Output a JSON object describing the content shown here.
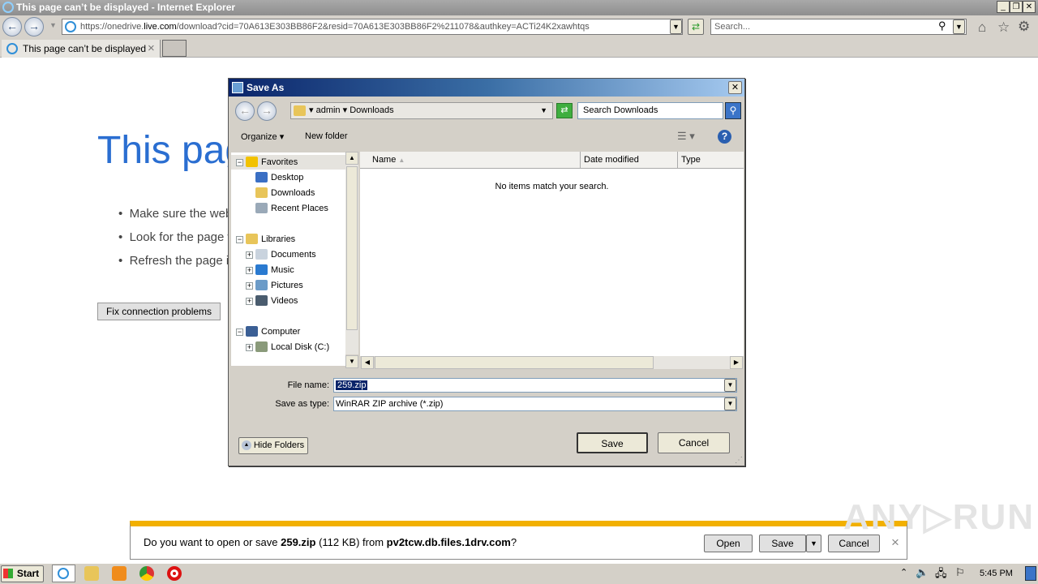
{
  "window": {
    "title": "This page can’t be displayed - Internet Explorer",
    "controls": [
      "_",
      "❐",
      "✕"
    ]
  },
  "address": {
    "prefix": "https://onedrive.",
    "domain": "live.com",
    "suffix": "/download?cid=70A613E303BB86F2&resid=70A613E303BB86F2%211078&authkey=ACTi24K2xawhtqs"
  },
  "search": {
    "placeholder": "Search..."
  },
  "tab": {
    "label": "This page can’t be displayed",
    "close": "×"
  },
  "page": {
    "heading": "This page can’t be displayed",
    "bullets": [
      "Make sure the web address is correct.",
      "Look for the page with your search engine.",
      "Refresh the page in a few minutes."
    ],
    "fix_button": "Fix connection problems"
  },
  "dialog": {
    "title": "Save As",
    "close": "✕",
    "breadcrumb": [
      "admin",
      "Downloads"
    ],
    "search_placeholder": "Search Downloads",
    "organize": "Organize ▾",
    "new_folder": "New folder",
    "columns": [
      "Name",
      "Date modified",
      "Type"
    ],
    "empty_message": "No items match your search.",
    "tree": [
      {
        "label": "Favorites",
        "level": 0,
        "exp": "−",
        "icon": "star",
        "color": "#f2c200"
      },
      {
        "label": "Desktop",
        "level": 1,
        "icon": "desktop",
        "color": "#3a6fc4"
      },
      {
        "label": "Downloads",
        "level": 1,
        "icon": "folder",
        "color": "#e8c55a"
      },
      {
        "label": "Recent Places",
        "level": 1,
        "icon": "recent",
        "color": "#9aa9b8"
      },
      {
        "label": "Libraries",
        "level": 0,
        "exp": "−",
        "icon": "library",
        "color": "#e8c55a",
        "gap": true
      },
      {
        "label": "Documents",
        "level": 1,
        "exp": "+",
        "icon": "documents",
        "color": "#c9d3de"
      },
      {
        "label": "Music",
        "level": 1,
        "exp": "+",
        "icon": "music",
        "color": "#2a7ad0"
      },
      {
        "label": "Pictures",
        "level": 1,
        "exp": "+",
        "icon": "pictures",
        "color": "#6b9bc8"
      },
      {
        "label": "Videos",
        "level": 1,
        "exp": "+",
        "icon": "videos",
        "color": "#4a5c6e"
      },
      {
        "label": "Computer",
        "level": 0,
        "exp": "−",
        "icon": "computer",
        "color": "#3b5f95",
        "gap": true
      },
      {
        "label": "Local Disk (C:)",
        "level": 1,
        "exp": "+",
        "icon": "disk",
        "color": "#8a9a7a"
      }
    ],
    "file_name_label": "File name:",
    "file_name": "259.zip",
    "save_type_label": "Save as type:",
    "save_type": "WinRAR ZIP archive (*.zip)",
    "hide_folders": "Hide Folders",
    "save": "Save",
    "cancel": "Cancel"
  },
  "download_bar": {
    "prefix": "Do you want to open or save ",
    "file": "259.zip",
    "size": " (112 KB) from ",
    "host": "pv2tcw.db.files.1drv.com",
    "suffix": "?",
    "open": "Open",
    "save": "Save",
    "cancel": "Cancel",
    "close": "×"
  },
  "taskbar": {
    "start": "Start",
    "clock": "5:45 PM"
  },
  "watermark": "ANY RUN",
  "colors": {
    "accent": "#2a6ed1",
    "download_bar": "#f2b000",
    "selection": "#0a246a"
  }
}
